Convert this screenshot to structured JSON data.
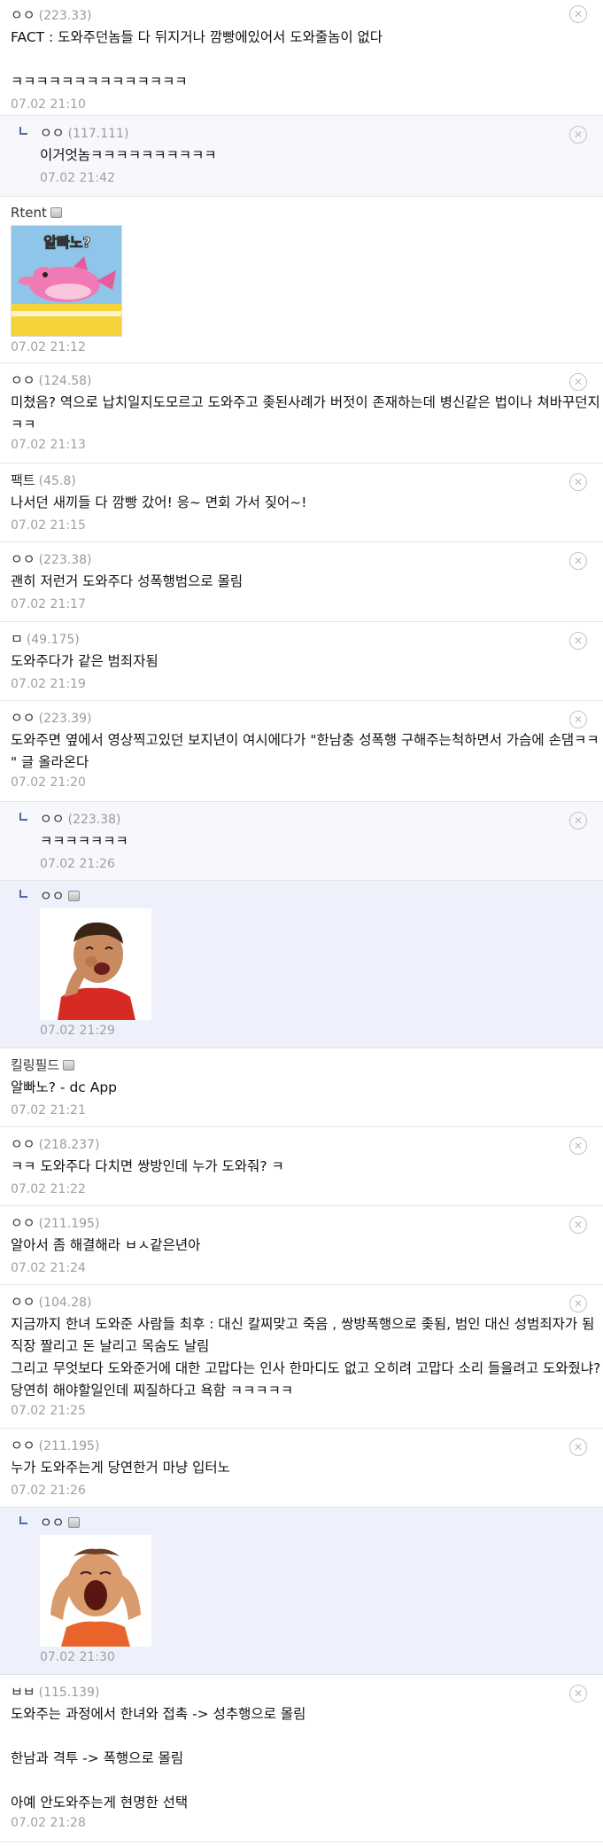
{
  "delete_glyph": "✕",
  "comments": [
    {
      "author": "ㅇㅇ",
      "ip": "(223.33)",
      "text": "FACT : 도와주던놈들 다 뒤지거나 깜빵에있어서 도와줄놈이 없다\n\nㅋㅋㅋㅋㅋㅋㅋㅋㅋㅋㅋㅋㅋㅋ",
      "date": "07.02 21:10"
    },
    {
      "author": "ㅇㅇ",
      "ip": "(117.111)",
      "text": "이거엇놈ㅋㅋㅋㅋㅋㅋㅋㅋㅋㅋ",
      "date": "07.02 21:42"
    },
    {
      "author": "Rtent",
      "image_label": "알빠노?",
      "date": "07.02 21:12"
    },
    {
      "author": "ㅇㅇ",
      "ip": "(124.58)",
      "text": "미쳤음? 역으로 납치일지도모르고 도와주고 좆된사례가 버젓이 존재하는데 병신같은 법이나 쳐바꾸던지 ㅋㅋ",
      "date": "07.02 21:13"
    },
    {
      "author": "팩트",
      "ip": "(45.8)",
      "text": "나서던 새끼들 다 깜빵 갔어! 응~ 면회 가서 짖어~!",
      "date": "07.02 21:15"
    },
    {
      "author": "ㅇㅇ",
      "ip": "(223.38)",
      "text": "괜히 저런거 도와주다 성폭행범으로 몰림",
      "date": "07.02 21:17"
    },
    {
      "author": "ㅁ",
      "ip": "(49.175)",
      "text": "도와주다가 같은 범죄자됨",
      "date": "07.02 21:19"
    },
    {
      "author": "ㅇㅇ",
      "ip": "(223.39)",
      "text": "도와주면 옆에서 영상찍고있던 보지년이 여시에다가 \"한남충 성폭행 구해주는척하면서 가슴에 손댐ㅋㅋ \" 글 올라온다",
      "date": "07.02 21:20"
    },
    {
      "author": "ㅇㅇ",
      "ip": "(223.38)",
      "text": "ㅋㅋㅋㅋㅋㅋㅋ",
      "date": "07.02 21:26"
    },
    {
      "author": "ㅇㅇ",
      "date": "07.02 21:29"
    },
    {
      "author": "킬링필드",
      "text": "알빠노? - dc App",
      "date": "07.02 21:21"
    },
    {
      "author": "ㅇㅇ",
      "ip": "(218.237)",
      "text": "ㅋㅋ 도와주다 다치면 쌍방인데 누가 도와줘? ㅋ",
      "date": "07.02 21:22"
    },
    {
      "author": "ㅇㅇ",
      "ip": "(211.195)",
      "text": "알아서 좀 해결해라 ㅂㅅ같은년아",
      "date": "07.02 21:24"
    },
    {
      "author": "ㅇㅇ",
      "ip": "(104.28)",
      "text": "지금까지 한녀 도와준 사람들 최후 : 대신 칼찌맞고 죽음 , 쌍방폭행으로 좆됨, 범인 대신 성범죄자가 됨 직장 짤리고 돈 날리고 목숨도 날림\n그리고 무엇보다 도와준거에 대한 고맙다는 인사 한마디도 없고 오히려 고맙다 소리 들을려고 도와줬냐? 당연히 해야할일인데 찌질하다고 욕함 ㅋㅋㅋㅋㅋ",
      "date": "07.02 21:25"
    },
    {
      "author": "ㅇㅇ",
      "ip": "(211.195)",
      "text": "누가 도와주는게 당연한거 마냥 입터노",
      "date": "07.02 21:26"
    },
    {
      "author": "ㅇㅇ",
      "date": "07.02 21:30"
    },
    {
      "author": "ㅂㅂ",
      "ip": "(115.139)",
      "text": "도와주는 과정에서 한녀와 접촉 -> 성추행으로 몰림\n\n한남과 격투 -> 폭행으로 몰림\n\n아예 안도와주는게 현명한 선택",
      "date": "07.02 21:28"
    }
  ]
}
